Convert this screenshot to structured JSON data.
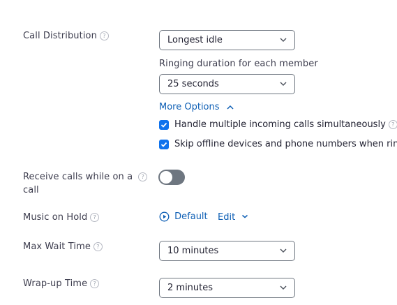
{
  "call_distribution": {
    "label": "Call Distribution",
    "value": "Longest idle"
  },
  "ringing": {
    "label": "Ringing duration for each member",
    "value": "25 seconds"
  },
  "more_options": {
    "label": "More Options"
  },
  "options": [
    {
      "label": "Handle multiple incoming calls simultaneously",
      "checked": true
    },
    {
      "label": "Skip offline devices and phone numbers when ring",
      "checked": true
    }
  ],
  "receive_calls": {
    "label_line1": "Receive calls while on a",
    "label_line2": "call",
    "enabled": false
  },
  "music_on_hold": {
    "label": "Music on Hold",
    "value": "Default",
    "edit_label": "Edit"
  },
  "max_wait": {
    "label": "Max Wait Time",
    "value": "10 minutes"
  },
  "wrap_up": {
    "label": "Wrap-up Time",
    "value": "2 minutes"
  },
  "help_glyph": "?",
  "colors": {
    "accent": "#0e72ed",
    "link": "#0e5fb5",
    "toggle_off": "#6e7680"
  }
}
